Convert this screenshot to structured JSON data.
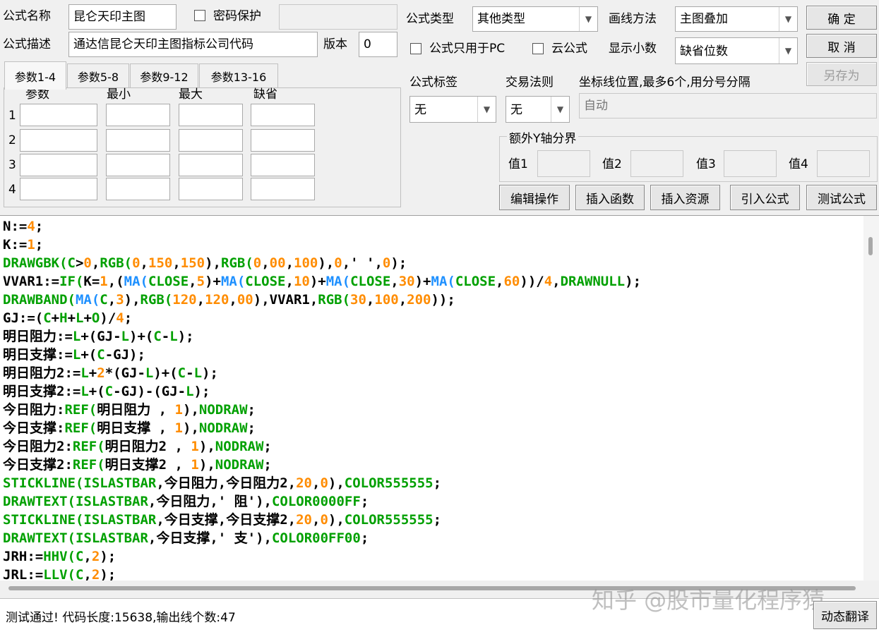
{
  "header": {
    "name_label": "公式名称",
    "name_value": "昆仑天印主图",
    "password_label": "密码保护",
    "password_value": "",
    "desc_label": "公式描述",
    "desc_value": "通达信昆仑天印主图指标公司代码",
    "version_label": "版本",
    "version_value": "0",
    "type_label": "公式类型",
    "type_value": "其他类型",
    "draw_method_label": "画线方法",
    "draw_method_value": "主图叠加",
    "pc_only_label": "公式只用于PC",
    "cloud_label": "云公式",
    "decimals_label": "显示小数",
    "decimals_value": "缺省位数"
  },
  "buttons": {
    "ok": "确 定",
    "cancel": "取 消",
    "save_as": "另存为",
    "edit_ops": "编辑操作",
    "insert_func": "插入函数",
    "insert_res": "插入资源",
    "import_formula": "引入公式",
    "test_formula": "测试公式",
    "dyn_translate": "动态翻译"
  },
  "tabs": [
    "参数1-4",
    "参数5-8",
    "参数9-12",
    "参数13-16"
  ],
  "param_headers": [
    "参数",
    "最小",
    "最大",
    "缺省"
  ],
  "param_rows": [
    "1",
    "2",
    "3",
    "4"
  ],
  "options": {
    "tag_label": "公式标签",
    "tag_value": "无",
    "rule_label": "交易法则",
    "rule_value": "无",
    "coord_label": "坐标线位置,最多6个,用分号分隔",
    "coord_value": "自动",
    "yaxis_title": "额外Y轴分界",
    "v1": "值1",
    "v2": "值2",
    "v3": "值3",
    "v4": "值4"
  },
  "code_lines": [
    [
      [
        "N:=",
        "p"
      ],
      [
        "4",
        "n"
      ],
      [
        ";",
        "p"
      ]
    ],
    [
      [
        "K:=",
        "p"
      ],
      [
        "1",
        "n"
      ],
      [
        ";",
        "p"
      ]
    ],
    [
      [
        "DRAWGBK(",
        "k"
      ],
      [
        "C",
        "k"
      ],
      [
        ">",
        "p"
      ],
      [
        "0",
        "n"
      ],
      [
        ",",
        "p"
      ],
      [
        "RGB(",
        "k"
      ],
      [
        "0",
        "n"
      ],
      [
        ",",
        "p"
      ],
      [
        "150",
        "n"
      ],
      [
        ",",
        "p"
      ],
      [
        "150",
        "n"
      ],
      [
        "),",
        "p"
      ],
      [
        "RGB(",
        "k"
      ],
      [
        "0",
        "n"
      ],
      [
        ",",
        "p"
      ],
      [
        "00",
        "n"
      ],
      [
        ",",
        "p"
      ],
      [
        "100",
        "n"
      ],
      [
        "),",
        "p"
      ],
      [
        "0",
        "n"
      ],
      [
        ",' ',",
        "p"
      ],
      [
        "0",
        "n"
      ],
      [
        ");",
        "p"
      ]
    ],
    [
      [
        "VVAR1:=",
        "p"
      ],
      [
        "IF(",
        "k"
      ],
      [
        "K=",
        "p"
      ],
      [
        "1",
        "n"
      ],
      [
        ",(",
        "p"
      ],
      [
        "MA(",
        "f"
      ],
      [
        "CLOSE",
        "k"
      ],
      [
        ",",
        "p"
      ],
      [
        "5",
        "n"
      ],
      [
        ")+",
        "p"
      ],
      [
        "MA(",
        "f"
      ],
      [
        "CLOSE",
        "k"
      ],
      [
        ",",
        "p"
      ],
      [
        "10",
        "n"
      ],
      [
        ")+",
        "p"
      ],
      [
        "MA(",
        "f"
      ],
      [
        "CLOSE",
        "k"
      ],
      [
        ",",
        "p"
      ],
      [
        "30",
        "n"
      ],
      [
        ")+",
        "p"
      ],
      [
        "MA(",
        "f"
      ],
      [
        "CLOSE",
        "k"
      ],
      [
        ",",
        "p"
      ],
      [
        "60",
        "n"
      ],
      [
        "))/",
        "p"
      ],
      [
        "4",
        "n"
      ],
      [
        ",",
        "p"
      ],
      [
        "DRAWNULL",
        "k"
      ],
      [
        ");",
        "p"
      ]
    ],
    [
      [
        "DRAWBAND(",
        "k"
      ],
      [
        "MA(",
        "f"
      ],
      [
        "C",
        "k"
      ],
      [
        ",",
        "p"
      ],
      [
        "3",
        "n"
      ],
      [
        "),",
        "p"
      ],
      [
        "RGB(",
        "k"
      ],
      [
        "120",
        "n"
      ],
      [
        ",",
        "p"
      ],
      [
        "120",
        "n"
      ],
      [
        ",",
        "p"
      ],
      [
        "00",
        "n"
      ],
      [
        "),VVAR1,",
        "p"
      ],
      [
        "RGB(",
        "k"
      ],
      [
        "30",
        "n"
      ],
      [
        ",",
        "p"
      ],
      [
        "100",
        "n"
      ],
      [
        ",",
        "p"
      ],
      [
        "200",
        "n"
      ],
      [
        "));",
        "p"
      ]
    ],
    [
      [
        "GJ:=(",
        "p"
      ],
      [
        "C",
        "k"
      ],
      [
        "+",
        "p"
      ],
      [
        "H",
        "k"
      ],
      [
        "+",
        "p"
      ],
      [
        "L",
        "k"
      ],
      [
        "+",
        "p"
      ],
      [
        "O",
        "k"
      ],
      [
        ")/",
        "p"
      ],
      [
        "4",
        "n"
      ],
      [
        ";",
        "p"
      ]
    ],
    [
      [
        "明日阻力:=",
        "p"
      ],
      [
        "L",
        "k"
      ],
      [
        "+(GJ-",
        "p"
      ],
      [
        "L",
        "k"
      ],
      [
        ")+(",
        "p"
      ],
      [
        "C",
        "k"
      ],
      [
        "-",
        "p"
      ],
      [
        "L",
        "k"
      ],
      [
        ");",
        "p"
      ]
    ],
    [
      [
        "明日支撑:=",
        "p"
      ],
      [
        "L",
        "k"
      ],
      [
        "+(",
        "p"
      ],
      [
        "C",
        "k"
      ],
      [
        "-GJ);",
        "p"
      ]
    ],
    [
      [
        "明日阻力2:=",
        "p"
      ],
      [
        "L",
        "k"
      ],
      [
        "+",
        "p"
      ],
      [
        "2",
        "n"
      ],
      [
        "*(GJ-",
        "p"
      ],
      [
        "L",
        "k"
      ],
      [
        ")+(",
        "p"
      ],
      [
        "C",
        "k"
      ],
      [
        "-",
        "p"
      ],
      [
        "L",
        "k"
      ],
      [
        ");",
        "p"
      ]
    ],
    [
      [
        "明日支撑2:=",
        "p"
      ],
      [
        "L",
        "k"
      ],
      [
        "+(",
        "p"
      ],
      [
        "C",
        "k"
      ],
      [
        "-GJ)-(GJ-",
        "p"
      ],
      [
        "L",
        "k"
      ],
      [
        ");",
        "p"
      ]
    ],
    [
      [
        "今日阻力:",
        "p"
      ],
      [
        "REF(",
        "k"
      ],
      [
        "明日阻力 , ",
        "p"
      ],
      [
        "1",
        "n"
      ],
      [
        "),",
        "p"
      ],
      [
        "NODRAW",
        "k"
      ],
      [
        ";",
        "p"
      ]
    ],
    [
      [
        "今日支撑:",
        "p"
      ],
      [
        "REF(",
        "k"
      ],
      [
        "明日支撑 , ",
        "p"
      ],
      [
        "1",
        "n"
      ],
      [
        "),",
        "p"
      ],
      [
        "NODRAW",
        "k"
      ],
      [
        ";",
        "p"
      ]
    ],
    [
      [
        "今日阻力2:",
        "p"
      ],
      [
        "REF(",
        "k"
      ],
      [
        "明日阻力2 , ",
        "p"
      ],
      [
        "1",
        "n"
      ],
      [
        "),",
        "p"
      ],
      [
        "NODRAW",
        "k"
      ],
      [
        ";",
        "p"
      ]
    ],
    [
      [
        "今日支撑2:",
        "p"
      ],
      [
        "REF(",
        "k"
      ],
      [
        "明日支撑2 , ",
        "p"
      ],
      [
        "1",
        "n"
      ],
      [
        "),",
        "p"
      ],
      [
        "NODRAW",
        "k"
      ],
      [
        ";",
        "p"
      ]
    ],
    [
      [
        "STICKLINE(",
        "k"
      ],
      [
        "ISLASTBAR",
        "k"
      ],
      [
        ",今日阻力,今日阻力2,",
        "p"
      ],
      [
        "20",
        "n"
      ],
      [
        ",",
        "p"
      ],
      [
        "0",
        "n"
      ],
      [
        "),",
        "p"
      ],
      [
        "COLOR555555",
        "k"
      ],
      [
        ";",
        "p"
      ]
    ],
    [
      [
        "DRAWTEXT(",
        "k"
      ],
      [
        "ISLASTBAR",
        "k"
      ],
      [
        ",今日阻力,' 阻'),",
        "p"
      ],
      [
        "COLOR0000FF",
        "k"
      ],
      [
        ";",
        "p"
      ]
    ],
    [
      [
        "STICKLINE(",
        "k"
      ],
      [
        "ISLASTBAR",
        "k"
      ],
      [
        ",今日支撑,今日支撑2,",
        "p"
      ],
      [
        "20",
        "n"
      ],
      [
        ",",
        "p"
      ],
      [
        "0",
        "n"
      ],
      [
        "),",
        "p"
      ],
      [
        "COLOR555555",
        "k"
      ],
      [
        ";",
        "p"
      ]
    ],
    [
      [
        "DRAWTEXT(",
        "k"
      ],
      [
        "ISLASTBAR",
        "k"
      ],
      [
        ",今日支撑,' 支'),",
        "p"
      ],
      [
        "COLOR00FF00",
        "k"
      ],
      [
        ";",
        "p"
      ]
    ],
    [
      [
        "JRH:=",
        "p"
      ],
      [
        "HHV(",
        "k"
      ],
      [
        "C",
        "k"
      ],
      [
        ",",
        "p"
      ],
      [
        "2",
        "n"
      ],
      [
        ");",
        "p"
      ]
    ],
    [
      [
        "JRL:=",
        "p"
      ],
      [
        "LLV(",
        "k"
      ],
      [
        "C",
        "k"
      ],
      [
        ",",
        "p"
      ],
      [
        "2",
        "n"
      ],
      [
        ");",
        "p"
      ]
    ]
  ],
  "status": {
    "message": "测试通过! 代码长度:15638,输出线个数:47"
  },
  "watermark": "知乎 @股市量化程序猿",
  "colors": {
    "keyword": "#00a000",
    "number": "#ff8c00",
    "function_ma": "#1e90ff"
  }
}
